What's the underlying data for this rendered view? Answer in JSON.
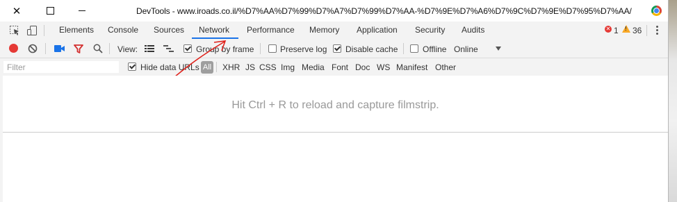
{
  "window": {
    "title": "DevTools - www.iroads.co.il/%D7%AA%D7%99%D7%A7%D7%99%D7%AA-%D7%9E%D7%A6%D7%9C%D7%9E%D7%95%D7%AA/"
  },
  "tabs": [
    {
      "label": "Elements"
    },
    {
      "label": "Console"
    },
    {
      "label": "Sources"
    },
    {
      "label": "Network",
      "active": true
    },
    {
      "label": "Performance"
    },
    {
      "label": "Memory"
    },
    {
      "label": "Application"
    },
    {
      "label": "Security"
    },
    {
      "label": "Audits"
    }
  ],
  "status": {
    "errors": "1",
    "warnings": "36"
  },
  "toolbar": {
    "view_label": "View:",
    "group_by_frame": {
      "label": "Group by frame",
      "checked": true
    },
    "preserve_log": {
      "label": "Preserve log",
      "checked": false
    },
    "disable_cache": {
      "label": "Disable cache",
      "checked": true
    },
    "offline": {
      "label": "Offline",
      "checked": false
    },
    "throttling": "Online"
  },
  "filterbar": {
    "placeholder": "Filter",
    "hide_data_urls": {
      "label": "Hide data URLs",
      "checked": true
    },
    "types": [
      "All",
      "XHR",
      "JS",
      "CSS",
      "Img",
      "Media",
      "Font",
      "Doc",
      "WS",
      "Manifest",
      "Other"
    ]
  },
  "filmstrip": {
    "message": "Hit Ctrl + R to reload and capture filmstrip."
  },
  "colors": {
    "record": "#e53935",
    "accent": "#1a73e8",
    "filter_icon": "#d32f2f",
    "camera_icon": "#1a73e8"
  },
  "icons": [
    "close-icon",
    "maximize-icon",
    "minimize-icon",
    "chrome-icon",
    "inspect-icon",
    "device-toggle-icon",
    "record-icon",
    "clear-icon",
    "camera-icon",
    "filter-icon",
    "search-icon",
    "list-view-icon",
    "waterfall-view-icon",
    "kebab-menu-icon"
  ]
}
